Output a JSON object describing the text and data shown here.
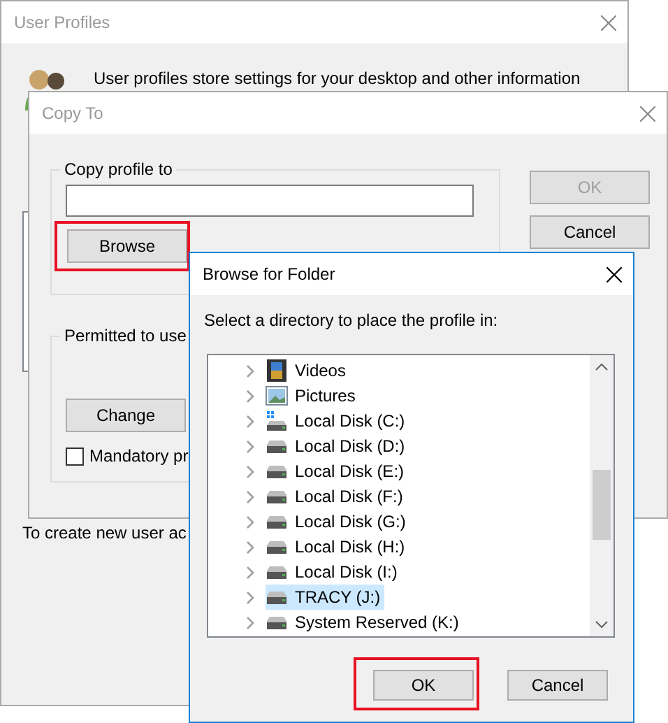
{
  "user_profiles": {
    "title": "User Profiles",
    "intro": "User profiles store settings for your desktop and other information",
    "footer": "To create new user ac"
  },
  "copy_to": {
    "title": "Copy To",
    "copy_group": {
      "legend": "Copy profile to",
      "browse_button": {
        "label": "Browse",
        "highlighted": true
      }
    },
    "permitted_group": {
      "legend": "Permitted to use",
      "change_button": "Change",
      "mandatory": {
        "label": "Mandatory pr",
        "checked": false
      }
    },
    "buttons": [
      {
        "label": "OK",
        "disabled": true
      },
      {
        "label": "Cancel",
        "disabled": false
      }
    ]
  },
  "browse_for_folder": {
    "title": "Browse for Folder",
    "prompt": "Select a directory to place the profile in:",
    "items": [
      {
        "label": "Videos",
        "kind": "videos",
        "selected": false
      },
      {
        "label": "Pictures",
        "kind": "pictures",
        "selected": false
      },
      {
        "label": "Local Disk (C:)",
        "kind": "system_drive",
        "selected": false
      },
      {
        "label": "Local Disk (D:)",
        "kind": "drive",
        "selected": false
      },
      {
        "label": "Local Disk (E:)",
        "kind": "drive",
        "selected": false
      },
      {
        "label": "Local Disk (F:)",
        "kind": "drive",
        "selected": false
      },
      {
        "label": "Local Disk (G:)",
        "kind": "drive",
        "selected": false
      },
      {
        "label": "Local Disk (H:)",
        "kind": "drive",
        "selected": false
      },
      {
        "label": "Local Disk (I:)",
        "kind": "drive",
        "selected": false
      },
      {
        "label": "TRACY (J:)",
        "kind": "drive",
        "selected": true
      },
      {
        "label": "System Reserved (K:)",
        "kind": "drive",
        "selected": false
      }
    ],
    "buttons": [
      {
        "label": "OK",
        "highlighted": true
      },
      {
        "label": "Cancel",
        "highlighted": false
      }
    ]
  }
}
